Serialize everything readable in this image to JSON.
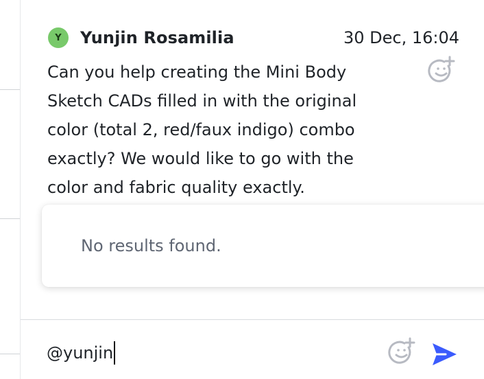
{
  "message": {
    "avatar_initial": "Y",
    "author": "Yunjin Rosamilia",
    "timestamp": "30 Dec, 16:04",
    "text": "Can you help creating the Mini Body Sketch CADs filled in with the original color (total 2, red/faux indigo) combo exactly? We would like to go with the color and fabric quality exactly.",
    "avatar_color": "#78c96a"
  },
  "mention_popup": {
    "empty_text": "No results found."
  },
  "composer": {
    "value": "@yunjin",
    "send_color": "#3b5bfd"
  },
  "icons": {
    "reaction": "add-reaction-icon",
    "send": "send-icon"
  }
}
